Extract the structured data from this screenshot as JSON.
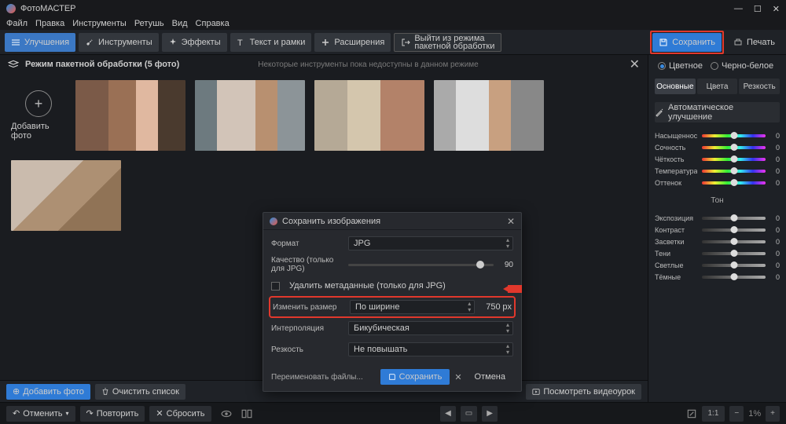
{
  "app_title": "ФотоМАСТЕР",
  "menu": [
    "Файл",
    "Правка",
    "Инструменты",
    "Ретушь",
    "Вид",
    "Справка"
  ],
  "toolbar": {
    "improvements": "Улучшения",
    "tools": "Инструменты",
    "effects": "Эффекты",
    "text_frames": "Текст и рамки",
    "extensions": "Расширения",
    "exit_batch_l1": "Выйти из режима",
    "exit_batch_l2": "пакетной обработки",
    "save": "Сохранить",
    "print": "Печать"
  },
  "batch": {
    "title": "Режим пакетной обработки (5 фото)",
    "unavailable_msg": "Некоторые инструменты пока недоступны в данном режиме",
    "add_photo": "Добавить фото"
  },
  "bottom": {
    "add_photo": "Добавить фото",
    "clear_list": "Очистить список",
    "watch_video": "Посмотреть видеоурок"
  },
  "status": {
    "undo": "Отменить",
    "redo": "Повторить",
    "reset": "Сбросить",
    "zoom": "1:1",
    "scale": "1%"
  },
  "sidebar": {
    "color": "Цветное",
    "bw": "Черно-белое",
    "tabs": {
      "main": "Основные",
      "colors": "Цвета",
      "sharp": "Резкость"
    },
    "auto": "Автоматическое улучшение",
    "sliders": [
      {
        "label": "Насыщенность",
        "val": "0",
        "type": "rainbow"
      },
      {
        "label": "Сочность",
        "val": "0",
        "type": "rainbow"
      },
      {
        "label": "Чёткость",
        "val": "0",
        "type": "rainbow"
      },
      {
        "label": "Температура",
        "val": "0",
        "type": "rainbow"
      },
      {
        "label": "Оттенок",
        "val": "0",
        "type": "rainbow"
      }
    ],
    "tone_label": "Тон",
    "tone_sliders": [
      {
        "label": "Экспозиция",
        "val": "0"
      },
      {
        "label": "Контраст",
        "val": "0"
      },
      {
        "label": "Засветки",
        "val": "0"
      },
      {
        "label": "Тени",
        "val": "0"
      },
      {
        "label": "Светлые",
        "val": "0"
      },
      {
        "label": "Тёмные",
        "val": "0"
      }
    ]
  },
  "dialog": {
    "title": "Сохранить изображения",
    "format_l": "Формат",
    "format_v": "JPG",
    "quality_l": "Качество (только для JPG)",
    "quality_v": "90",
    "metadata": "Удалить метаданные (только для JPG)",
    "resize_l": "Изменить размер",
    "resize_v": "По ширине",
    "resize_px": "750",
    "px": "px",
    "interp_l": "Интерполяция",
    "interp_v": "Бикубическая",
    "sharp_l": "Резкость",
    "sharp_v": "Не повышать",
    "rename": "Переименовать файлы...",
    "save": "Сохранить",
    "cancel": "Отмена"
  }
}
